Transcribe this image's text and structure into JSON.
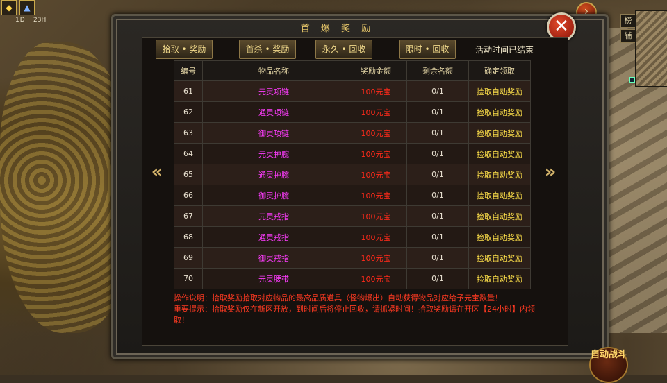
{
  "hud": {
    "level_label": "1D",
    "time_label": "23H"
  },
  "side_tabs": [
    "榜",
    "辅"
  ],
  "panel": {
    "title": "首 爆 奖 励",
    "tabs": [
      {
        "label": "拾取 • 奖励"
      },
      {
        "label": "首杀 • 奖励"
      },
      {
        "label": "永久 • 回收"
      },
      {
        "label": "限时 • 回收"
      }
    ],
    "status": "活动时间已结束"
  },
  "table": {
    "headers": [
      "编号",
      "物品名称",
      "奖励金额",
      "剩余名额",
      "确定领取"
    ],
    "rows": [
      {
        "no": "61",
        "name": "元灵项链",
        "amount": "100元宝",
        "left": "0/1",
        "action": "捡取自动奖励"
      },
      {
        "no": "62",
        "name": "通灵项链",
        "amount": "100元宝",
        "left": "0/1",
        "action": "捡取自动奖励"
      },
      {
        "no": "63",
        "name": "御灵项链",
        "amount": "100元宝",
        "left": "0/1",
        "action": "捡取自动奖励"
      },
      {
        "no": "64",
        "name": "元灵护腕",
        "amount": "100元宝",
        "left": "0/1",
        "action": "捡取自动奖励"
      },
      {
        "no": "65",
        "name": "通灵护腕",
        "amount": "100元宝",
        "left": "0/1",
        "action": "捡取自动奖励"
      },
      {
        "no": "66",
        "name": "御灵护腕",
        "amount": "100元宝",
        "left": "0/1",
        "action": "捡取自动奖励"
      },
      {
        "no": "67",
        "name": "元灵戒指",
        "amount": "100元宝",
        "left": "0/1",
        "action": "捡取自动奖励"
      },
      {
        "no": "68",
        "name": "通灵戒指",
        "amount": "100元宝",
        "left": "0/1",
        "action": "捡取自动奖励"
      },
      {
        "no": "69",
        "name": "御灵戒指",
        "amount": "100元宝",
        "left": "0/1",
        "action": "捡取自动奖励"
      },
      {
        "no": "70",
        "name": "元灵腰带",
        "amount": "100元宝",
        "left": "0/1",
        "action": "捡取自动奖励"
      }
    ]
  },
  "notes": {
    "line1": "操作说明：拾取奖励拾取对应物品的最高品质道具（怪物爆出）自动获得物品对应给予元宝数量！",
    "line2": "重要提示：拾取奖励仅在新区开放，到时间后将停止回收，请抓紧时间！拾取奖励请在开区【24小时】内领取！"
  },
  "auto_button": {
    "label": "自动战斗"
  },
  "icons": {
    "close": "close-icon",
    "prev": "prev-page-icon",
    "next": "next-page-icon",
    "expand": "expand-arrow-icon"
  },
  "colors": {
    "item_name": "#ff3cff",
    "amount": "#ff2a1a",
    "action": "#ffe14a",
    "notes": "#ff3a22",
    "title": "#e8c86a"
  }
}
